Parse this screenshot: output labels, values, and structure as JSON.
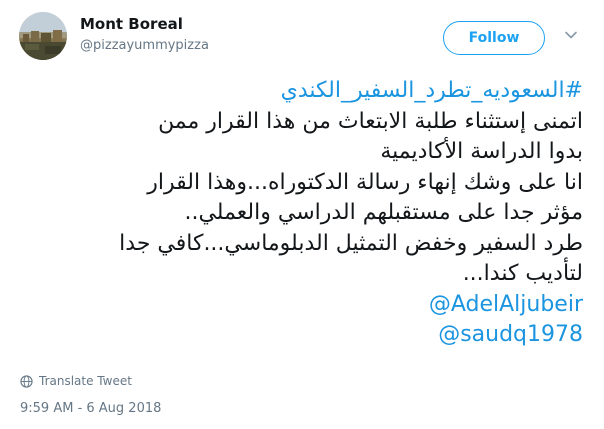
{
  "user": {
    "name": "Mont Boreal",
    "handle": "@pizzayummypizza"
  },
  "actions": {
    "follow_label": "Follow"
  },
  "icons": {
    "menu": "chevron-down-icon",
    "translate": "globe-icon"
  },
  "tweet": {
    "hashtag": "#السعوديه_تطرد_السفير_الكندي",
    "lines": [
      "اتمنى إستثناء طلبة الابتعاث من هذا القرار ممن",
      "بدوا الدراسة الأكاديمية",
      "انا على وشك إنهاء رسالة الدكتوراه...وهذا القرار",
      "مؤثر جدا على مستقبلهم الدراسي والعملي..",
      "طرد السفير وخفض التمثيل الدبلوماسي...كافي جدا",
      "لتأديب كندا..."
    ],
    "mentions": [
      "@AdelAljubeir",
      "@saudq1978"
    ]
  },
  "translate_label": "Translate Tweet",
  "timestamp": "9:59 AM - 6 Aug 2018",
  "colors": {
    "link": "#1b95e0",
    "follow": "#1da1f2",
    "muted": "#657786",
    "text": "#14171a"
  }
}
